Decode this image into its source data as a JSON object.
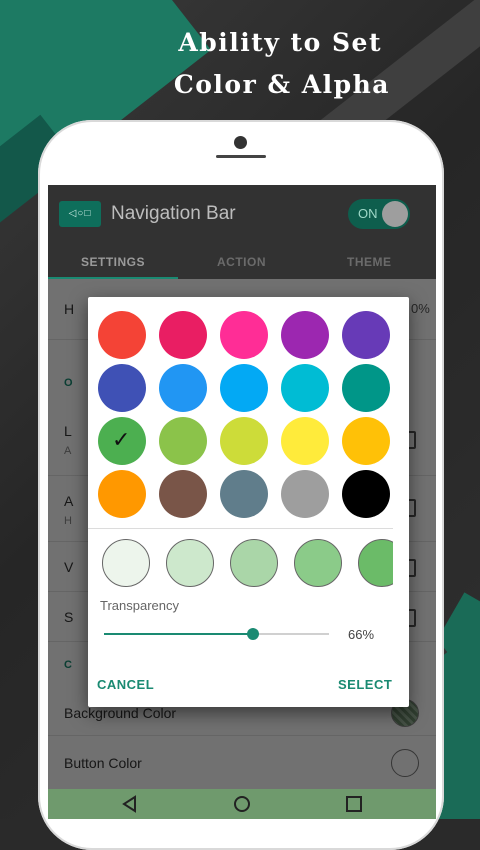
{
  "promo": {
    "line1": "Ability to Set",
    "line2": "Color & Alpha"
  },
  "app": {
    "icon_text": "◁○□",
    "title": "Navigation Bar",
    "switch_label": "ON",
    "tabs": [
      {
        "label": "SETTINGS"
      },
      {
        "label": "ACTION"
      },
      {
        "label": "THEME"
      }
    ]
  },
  "list": {
    "row_h_partial": "H",
    "row_h_value": "0%",
    "cat_o": "O",
    "row_l": "L",
    "row_l_sub": "A",
    "row_a": "A",
    "row_a_sub": "H",
    "row_v": "V",
    "row_s": "S",
    "cat_c": "C",
    "background_color": "Background Color",
    "button_color": "Button Color"
  },
  "dialog": {
    "colors": [
      "#f44336",
      "#e91e63",
      "#ff2d96",
      "#9c27b0",
      "#673ab7",
      "#3f51b5",
      "#2196f3",
      "#03a9f4",
      "#00bcd4",
      "#009688",
      "#4caf50",
      "#8bc34a",
      "#cddc39",
      "#ffeb3b",
      "#ffc107",
      "#ff9800",
      "#795548",
      "#607d8b",
      "#9e9e9e",
      "#000000"
    ],
    "selected_index": 10,
    "check_glyph": "✓",
    "shades": [
      "#edf5ec",
      "#cde8cc",
      "#aad6a8",
      "#8bcb89",
      "#6bbb68"
    ],
    "transparency_label": "Transparency",
    "transparency_value": 66,
    "transparency_text": "66%",
    "cancel_label": "CANCEL",
    "select_label": "SELECT"
  },
  "colors": {
    "accent": "#1a8a72",
    "appbar": "#323232",
    "navbar": "#6f9a6d"
  }
}
